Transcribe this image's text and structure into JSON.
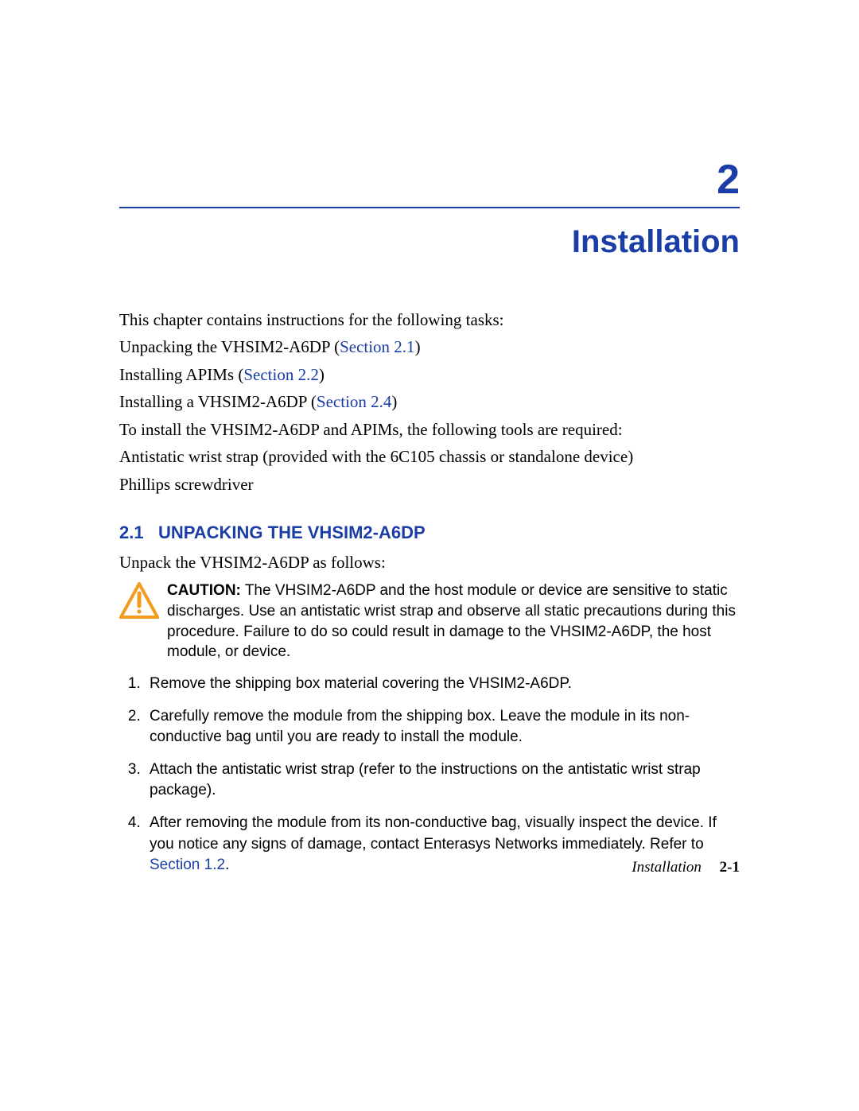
{
  "chapter": {
    "number": "2",
    "title": "Installation"
  },
  "intro": {
    "lead": "This chapter contains instructions for the following tasks:",
    "tasks": [
      {
        "text": "Unpacking the VHSIM2-A6DP (",
        "link": "Section 2.1",
        "tail": ")"
      },
      {
        "text": "Installing APIMs (",
        "link": "Section 2.2",
        "tail": ")"
      },
      {
        "text": "Installing a VHSIM2-A6DP (",
        "link": "Section 2.4",
        "tail": ")"
      }
    ],
    "tools_lead": "To install the VHSIM2-A6DP and APIMs, the following tools are required:",
    "tools": [
      "Antistatic wrist strap (provided with the 6C105 chassis or standalone device)",
      "Phillips screwdriver"
    ]
  },
  "section": {
    "number": "2.1",
    "title": "UNPACKING THE VHSIM2-A6DP",
    "lead": "Unpack the VHSIM2-A6DP as follows:",
    "caution_label": "CAUTION:",
    "caution_text": " The VHSIM2-A6DP and the host module or device are sensitive to static discharges. Use an antistatic wrist strap and observe all static precautions during this procedure. Failure to do so could result in damage to the VHSIM2-A6DP, the host module, or device.",
    "steps": [
      "Remove the shipping box material covering the VHSIM2-A6DP.",
      "Carefully remove the module from the shipping box. Leave the module in its non-conductive bag until you are ready to install the module.",
      "Attach the antistatic wrist strap (refer to the instructions on the antistatic wrist strap package)."
    ],
    "step4_pre": "After removing the module from its non-conductive bag, visually inspect the device. If you notice any signs of damage, contact Enterasys Networks immediately. Refer to ",
    "step4_link": "Section 1.2",
    "step4_tail": "."
  },
  "footer": {
    "name": "Installation",
    "num": "2-1"
  }
}
